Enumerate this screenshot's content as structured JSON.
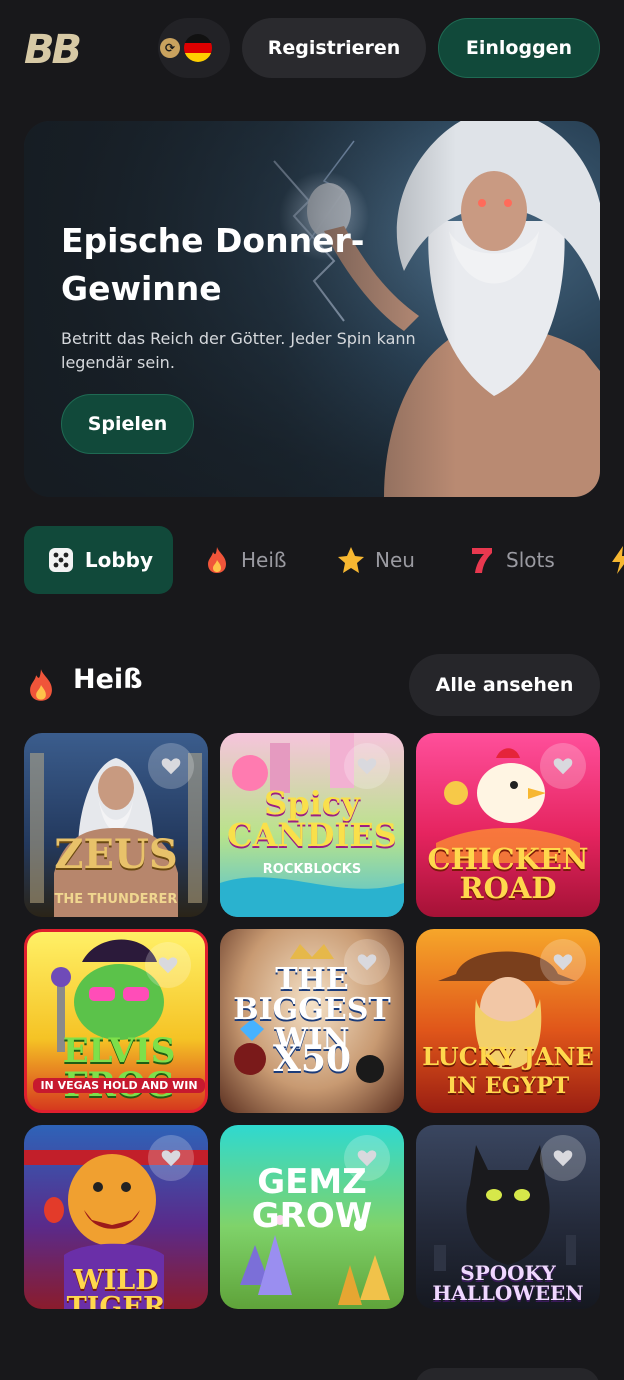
{
  "header": {
    "logo_text": "BB",
    "lang_flag": "de",
    "register_label": "Registrieren",
    "login_label": "Einloggen"
  },
  "hero": {
    "title": "Epische Donner-Gewinne",
    "subtitle": "Betritt das Reich der Götter. Jeder Spin kann legendär sein.",
    "cta_label": "Spielen"
  },
  "tabs": [
    {
      "label": "Lobby",
      "icon": "dice-icon",
      "active": true
    },
    {
      "label": "Heiß",
      "icon": "fire-icon",
      "active": false
    },
    {
      "label": "Neu",
      "icon": "star-icon",
      "active": false
    },
    {
      "label": "Slots",
      "icon": "seven-icon",
      "active": false
    }
  ],
  "section": {
    "title": "Heiß",
    "icon": "fire-icon",
    "see_all_label": "Alle ansehen"
  },
  "games": [
    {
      "title": "ZEUS",
      "subtitle": "THE THUNDERER"
    },
    {
      "title": "Spicy CANDIES",
      "subtitle": "ROCKBLOCKS"
    },
    {
      "title": "CHICKEN ROAD",
      "subtitle": ""
    },
    {
      "title": "ELVIS FROG",
      "subtitle": "IN VEGAS HOLD AND WIN"
    },
    {
      "title": "THE BIGGEST WIN",
      "subtitle": "X50"
    },
    {
      "title": "LUCKY JANE",
      "subtitle": "IN EGYPT"
    },
    {
      "title": "WILD TIGER",
      "subtitle": ""
    },
    {
      "title": "GEMZ GROW",
      "subtitle": ""
    },
    {
      "title": "SPOOKY HALLOWEEN",
      "subtitle": ""
    }
  ],
  "colors": {
    "background": "#18181b",
    "accent": "#11493a",
    "button": "#2a2a2e"
  }
}
